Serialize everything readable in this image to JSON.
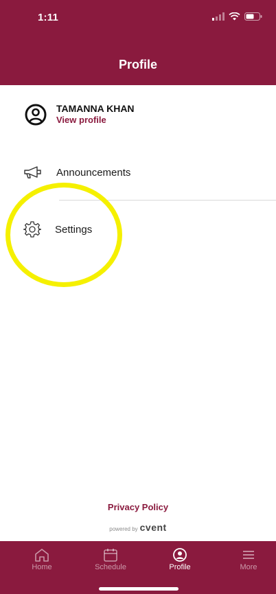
{
  "status_bar": {
    "time": "1:11"
  },
  "header": {
    "title": "Profile"
  },
  "profile": {
    "name": "TAMANNA KHAN",
    "link": "View profile"
  },
  "menu": {
    "items": [
      {
        "label": "Announcements",
        "icon": "megaphone-icon"
      },
      {
        "label": "Settings",
        "icon": "gear-icon"
      }
    ]
  },
  "footer": {
    "privacy": "Privacy Policy",
    "powered_by": "powered by",
    "brand": "cvent"
  },
  "tabs": [
    {
      "label": "Home",
      "icon": "home-icon"
    },
    {
      "label": "Schedule",
      "icon": "calendar-icon"
    },
    {
      "label": "Profile",
      "icon": "profile-icon",
      "active": true
    },
    {
      "label": "More",
      "icon": "menu-icon"
    }
  ],
  "colors": {
    "brand": "#8a1a3e",
    "highlight": "#f5f000"
  }
}
